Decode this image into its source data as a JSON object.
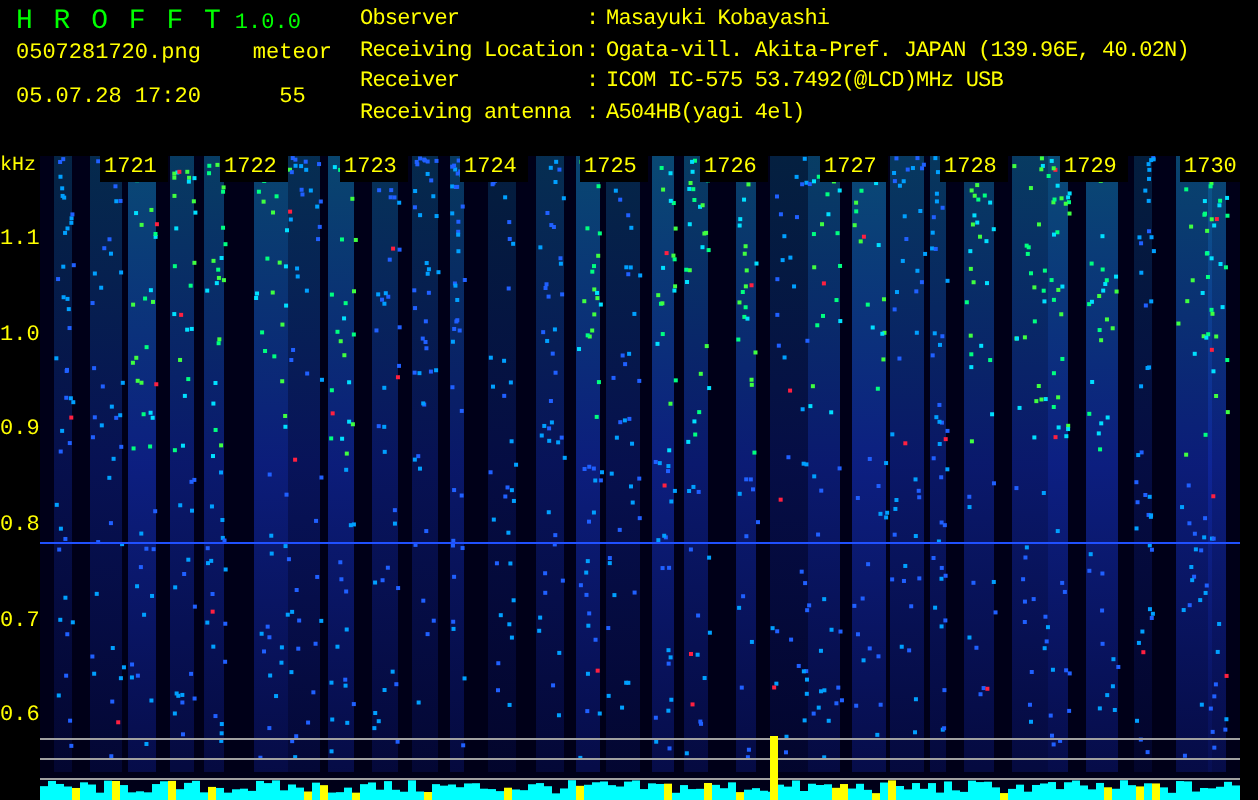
{
  "app": {
    "title": "H R O F F T",
    "version": "1.0.0"
  },
  "file": {
    "name": "0507281720.png",
    "datetime": "05.07.28 17:20"
  },
  "meteor": {
    "label": "meteor",
    "count": "55"
  },
  "info": [
    {
      "label": "Observer",
      "sep": ":",
      "value": "Masayuki Kobayashi"
    },
    {
      "label": "Receiving Location",
      "sep": ":",
      "value": "Ogata-vill. Akita-Pref. JAPAN (139.96E, 40.02N)"
    },
    {
      "label": "Receiver",
      "sep": ":",
      "value": "ICOM IC-575 53.7492(@LCD)MHz USB"
    },
    {
      "label": "Receiving antenna",
      "sep": ":",
      "value": "A504HB(yagi 4el)"
    }
  ],
  "axis": {
    "unit": "kHz",
    "yticks": [
      "1.1",
      "1.0",
      "0.9",
      "0.8",
      "0.7",
      "0.6"
    ],
    "times": [
      "1721",
      "1722",
      "1723",
      "1724",
      "1725",
      "1726",
      "1727",
      "1728",
      "1729",
      "1730"
    ]
  }
}
